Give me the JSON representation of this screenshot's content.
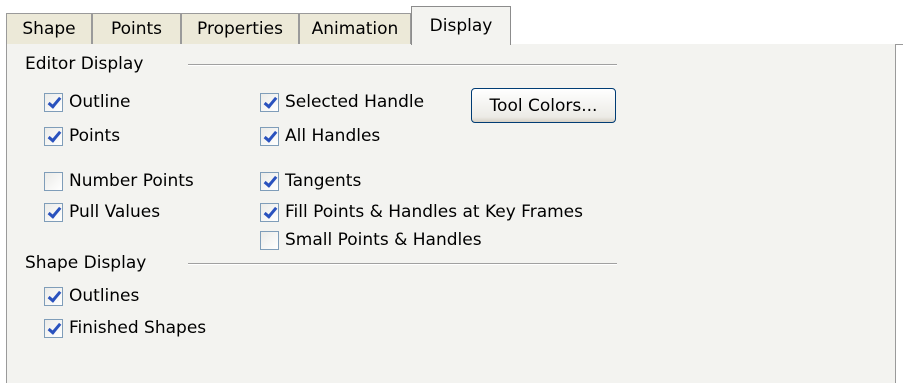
{
  "tabs": [
    {
      "label": "Shape",
      "active": false
    },
    {
      "label": "Points",
      "active": false
    },
    {
      "label": "Properties",
      "active": false
    },
    {
      "label": "Animation",
      "active": false
    },
    {
      "label": "Display",
      "active": true
    }
  ],
  "editor_display": {
    "title": "Editor Display",
    "left_options": [
      {
        "label": "Outline",
        "checked": true
      },
      {
        "label": "Points",
        "checked": true
      },
      {
        "label": "Number Points",
        "checked": false
      },
      {
        "label": "Pull Values",
        "checked": true
      }
    ],
    "right_options": [
      {
        "label": "Selected Handle",
        "checked": true
      },
      {
        "label": "All Handles",
        "checked": true
      },
      {
        "label": "Tangents",
        "checked": true
      },
      {
        "label": "Fill Points & Handles at Key Frames",
        "checked": true
      },
      {
        "label": "Small Points & Handles",
        "checked": false
      }
    ],
    "tool_colors_button": "Tool Colors..."
  },
  "shape_display": {
    "title": "Shape Display",
    "options": [
      {
        "label": "Outlines",
        "checked": true
      },
      {
        "label": "Finished Shapes",
        "checked": true
      }
    ]
  },
  "colors": {
    "panel_bg": "#f3f3f0",
    "inactive_tab_bg": "#ece9d8",
    "check_mark": "#2a52be"
  }
}
